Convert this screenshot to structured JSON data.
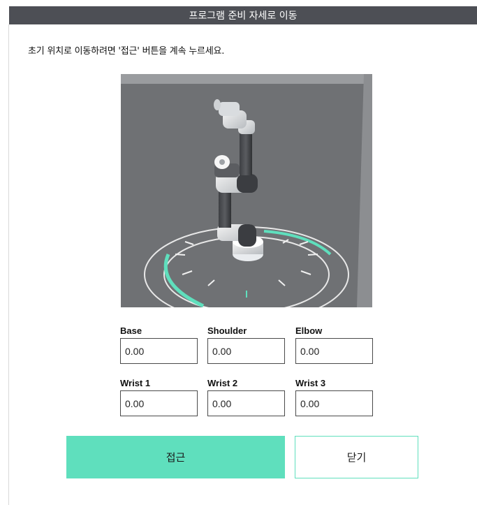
{
  "dialog": {
    "title": "프로그램 준비 자세로 이동",
    "instruction": "초기 위치로 이동하려면 '접근' 버튼을 계속 누르세요."
  },
  "robot_view": {
    "icon": "robot-arm-3d-view"
  },
  "joints": [
    {
      "label": "Base",
      "value": "0.00"
    },
    {
      "label": "Shoulder",
      "value": "0.00"
    },
    {
      "label": "Elbow",
      "value": "0.00"
    },
    {
      "label": "Wrist 1",
      "value": "0.00"
    },
    {
      "label": "Wrist 2",
      "value": "0.00"
    },
    {
      "label": "Wrist 3",
      "value": "0.00"
    }
  ],
  "buttons": {
    "approach": "접근",
    "close": "닫기"
  },
  "colors": {
    "titlebar": "#4d4f55",
    "accent": "#5fdfbd",
    "viewport_bg": "#6e7073"
  }
}
